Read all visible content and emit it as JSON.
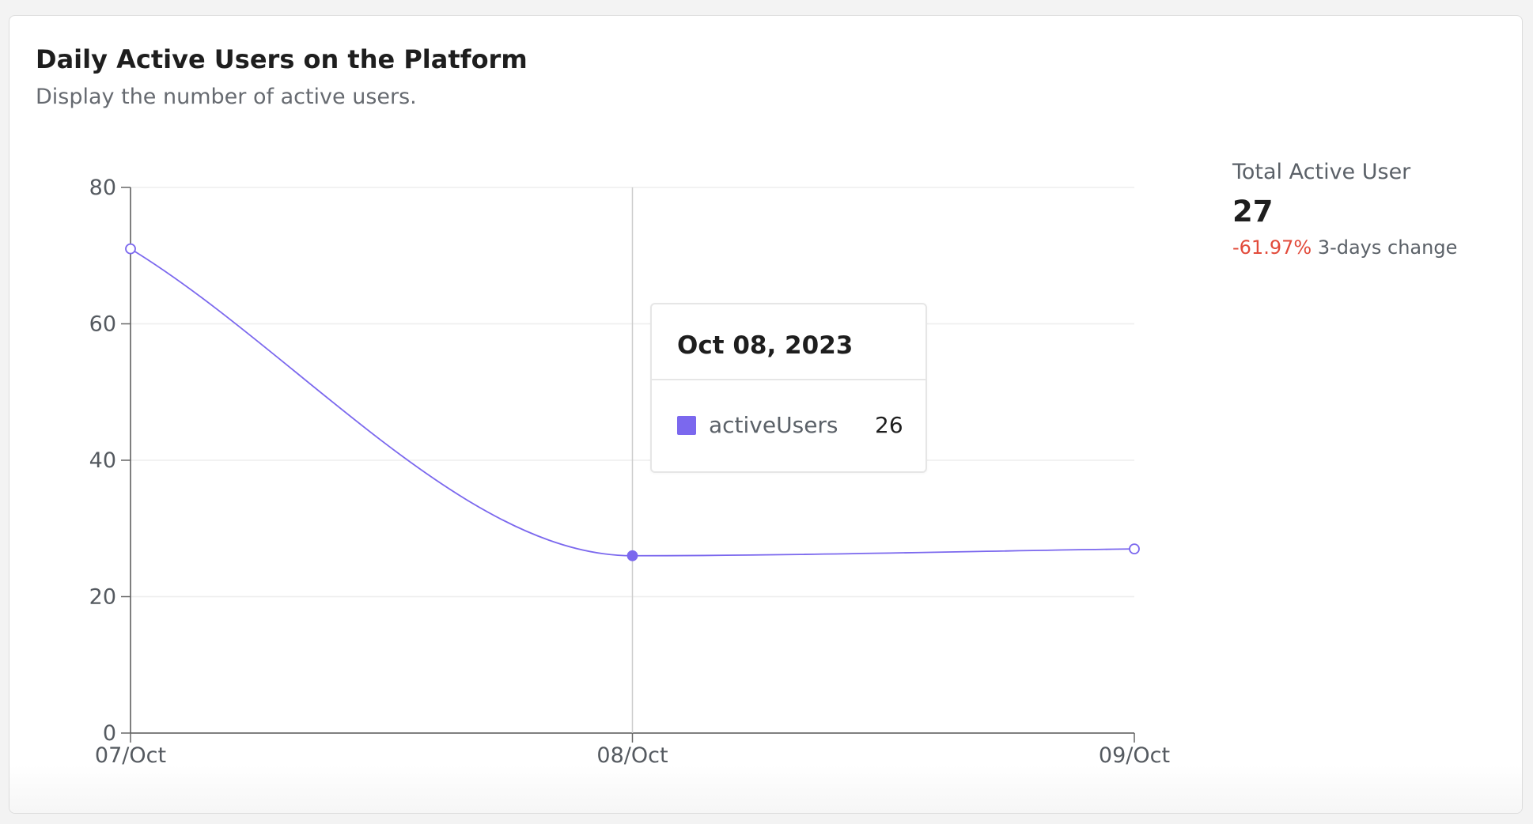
{
  "card": {
    "title": "Daily Active Users on the Platform",
    "subtitle": "Display the number of active users."
  },
  "summary": {
    "label": "Total Active User",
    "value": "27",
    "change_pct": "-61.97%",
    "change_text": "3-days change"
  },
  "tooltip": {
    "date": "Oct 08, 2023",
    "series_name": "activeUsers",
    "value": "26"
  },
  "colors": {
    "accent": "#7b68ee",
    "negative": "#e24b3b"
  },
  "chart_data": {
    "type": "line",
    "categories": [
      "07/Oct",
      "08/Oct",
      "09/Oct"
    ],
    "series": [
      {
        "name": "activeUsers",
        "values": [
          71,
          26,
          27
        ]
      }
    ],
    "yticks": [
      "0",
      "20",
      "40",
      "60",
      "80"
    ],
    "ylim": [
      0,
      80
    ],
    "grid": true,
    "highlighted_category": "08/Oct"
  }
}
